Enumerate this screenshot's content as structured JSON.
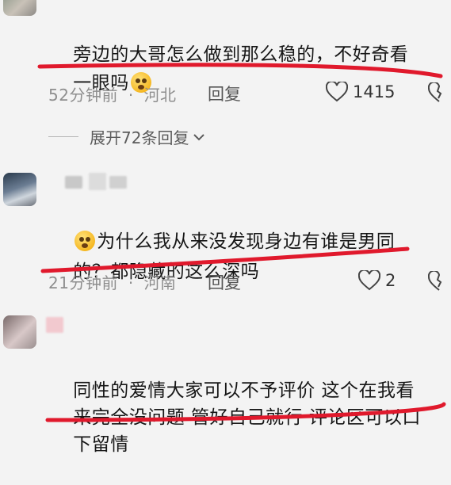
{
  "comments": [
    {
      "text_line1": "旁边的大哥怎么做到那么稳的，不好奇看",
      "text_line2": "一眼吗",
      "time": "52分钟前",
      "location": "河北",
      "reply_label": "回复",
      "likes": "1415",
      "expand_label": "展开72条回复"
    },
    {
      "text_line1": "为什么我从来没发现身边有谁是男同",
      "text_line2": "的？都隐藏的这么深吗",
      "time": "21分钟前",
      "location": "河南",
      "reply_label": "回复",
      "likes": "2"
    },
    {
      "text_line1": "同性的爱情大家可以不予评价 这个在我看",
      "text_line2": "来完全没问题 管好自己就行 评论区可以口",
      "text_line3": "下留情"
    }
  ],
  "meta_separator": "·",
  "colors": {
    "underline": "#e0192c",
    "meta_text": "#8e8e8e",
    "background": "#f3f3f3"
  },
  "icons": [
    "heart-icon",
    "dislike-icon",
    "chevron-down-icon",
    "emoji-icon"
  ]
}
